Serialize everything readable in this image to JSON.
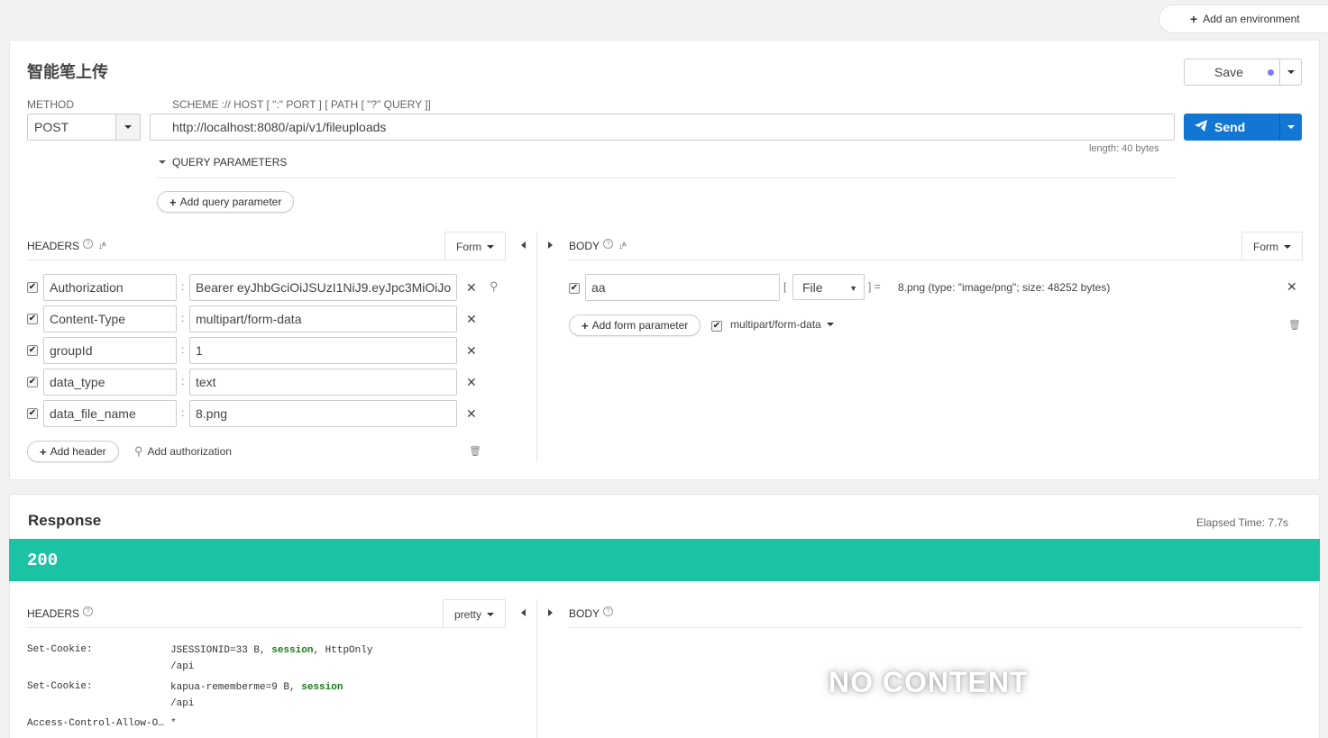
{
  "top": {
    "add_env_label": "Add an environment"
  },
  "request": {
    "title": "智能笔上传",
    "save_label": "Save",
    "method_label": "METHOD",
    "scheme_label": "SCHEME :// HOST [ \":\" PORT ] [ PATH [ \"?\" QUERY ]]",
    "method": "POST",
    "url": "http://localhost:8080/api/v1/fileuploads",
    "send_label": "Send",
    "length_text": "length: 40 bytes",
    "query_params_label": "QUERY PARAMETERS",
    "add_query_param_label": "Add query parameter",
    "headers_label": "HEADERS",
    "headers_mode": "Form",
    "headers": [
      {
        "key": "Authorization",
        "value": "Bearer eyJhbGciOiJSUzI1NiJ9.eyJpc3MiOiJo",
        "enabled": true
      },
      {
        "key": "Content-Type",
        "value": "multipart/form-data",
        "enabled": true
      },
      {
        "key": "groupId",
        "value": "1",
        "enabled": true
      },
      {
        "key": "data_type",
        "value": "text",
        "enabled": true
      },
      {
        "key": "data_file_name",
        "value": "8.png",
        "enabled": true
      }
    ],
    "add_header_label": "Add header",
    "add_authorization_label": "Add authorization",
    "body_label": "BODY",
    "body_mode": "Form",
    "body_params": [
      {
        "key": "aa",
        "type": "File",
        "open_bracket": "[",
        "close_bracket": "] =",
        "info": "8.png (type: \"image/png\"; size: 48252 bytes)",
        "enabled": true
      }
    ],
    "add_form_param_label": "Add form parameter",
    "multipart_label": "multipart/form-data"
  },
  "response": {
    "title": "Response",
    "elapsed": "Elapsed Time: 7.7s",
    "status_code": "200",
    "headers_label": "HEADERS",
    "headers_mode": "pretty",
    "body_label": "BODY",
    "headers": [
      {
        "name": "Set-Cookie:",
        "value_main": "JSESSIONID=33 B, ",
        "value_kw": "session",
        "value_tail": ", HttpOnly",
        "value_path": "/api"
      },
      {
        "name": "Set-Cookie:",
        "value_main": "kapua-rememberme=9 B, ",
        "value_kw": "session",
        "value_tail": "",
        "value_path": "/api"
      },
      {
        "name": "Access-Control-Allow-O…",
        "value_main": "*",
        "value_kw": "",
        "value_tail": "",
        "value_path": ""
      }
    ],
    "no_content": "NO CONTENT"
  },
  "colors": {
    "send": "#1276d3",
    "status_ok": "#1bc2a3",
    "keyword": "#1a7a1a",
    "save_dot": "#7b7bf7"
  },
  "icons": [
    "plus-icon",
    "paper-plane-icon",
    "help-icon",
    "sort-icon",
    "close-icon",
    "key-icon",
    "trash-icon",
    "caret-down-icon",
    "arrow-left-icon",
    "arrow-right-icon",
    "checkbox-icon"
  ]
}
